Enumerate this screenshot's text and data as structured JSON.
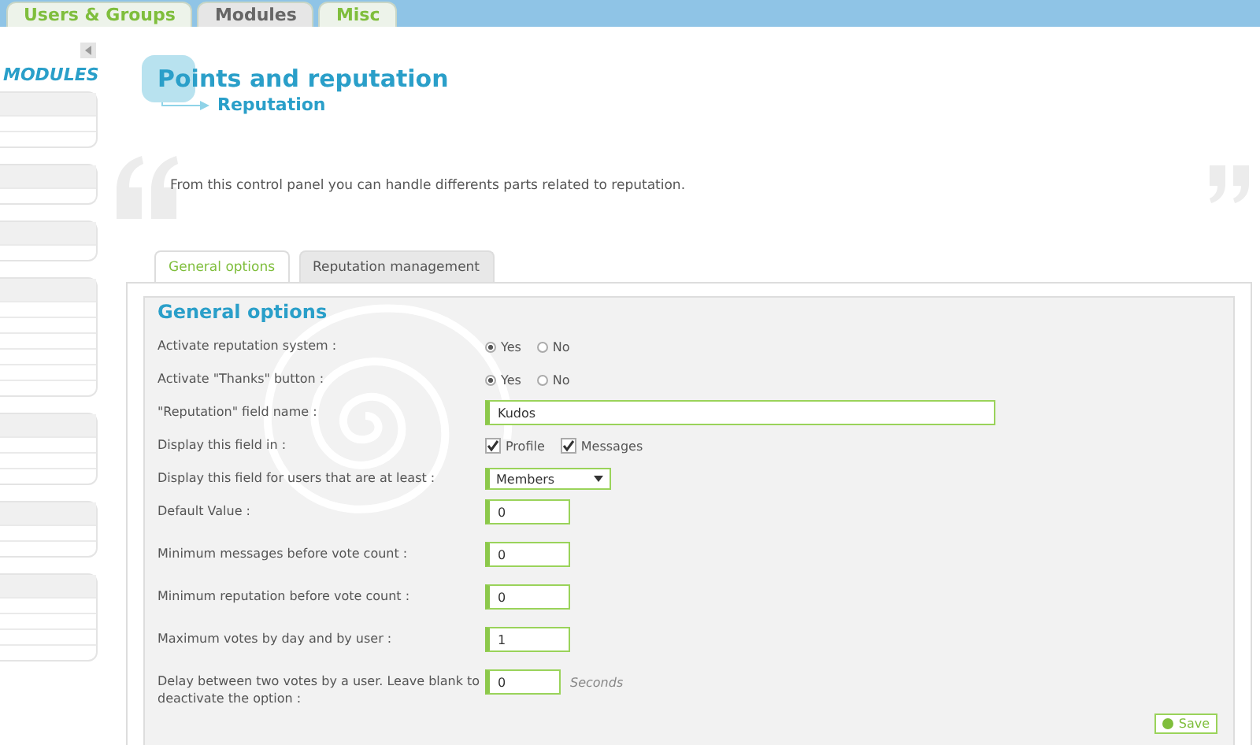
{
  "top_tabs": [
    {
      "label": "Users & Groups",
      "selected": false
    },
    {
      "label": "Modules",
      "selected": true
    },
    {
      "label": "Misc",
      "selected": false
    }
  ],
  "sidebar": {
    "title": "MODULES"
  },
  "header": {
    "title": "Points and reputation",
    "subtitle": "Reputation"
  },
  "intro": "From this control panel you can handle differents parts related to reputation.",
  "sub_tabs": [
    {
      "label": "General options",
      "selected": true
    },
    {
      "label": "Reputation management",
      "selected": false
    }
  ],
  "section_title": "General options",
  "fields": [
    {
      "kind": "radio",
      "label": "Activate reputation system :",
      "options": [
        {
          "label": "Yes",
          "selected": true
        },
        {
          "label": "No",
          "selected": false
        }
      ]
    },
    {
      "kind": "radio",
      "label": "Activate \"Thanks\" button :",
      "options": [
        {
          "label": "Yes",
          "selected": true
        },
        {
          "label": "No",
          "selected": false
        }
      ]
    },
    {
      "kind": "text",
      "label": "\"Reputation\" field name :",
      "value": "Kudos"
    },
    {
      "kind": "checkbox",
      "label": "Display this field in :",
      "options": [
        {
          "label": "Profile",
          "checked": true
        },
        {
          "label": "Messages",
          "checked": true
        }
      ]
    },
    {
      "kind": "select",
      "label": "Display this field for users that are at least :",
      "value": "Members"
    },
    {
      "kind": "number",
      "label": "Default Value :",
      "value": "0"
    },
    {
      "kind": "number",
      "label": "Minimum messages before vote count :",
      "value": "0"
    },
    {
      "kind": "number",
      "label": "Minimum reputation before vote count :",
      "value": "0"
    },
    {
      "kind": "number",
      "label": "Maximum votes by day and by user :",
      "value": "1"
    },
    {
      "kind": "number",
      "label": "Delay between two votes by a user. Leave blank to deactivate the option :",
      "value": "0",
      "unit": "Seconds"
    }
  ],
  "save_label": "Save"
}
